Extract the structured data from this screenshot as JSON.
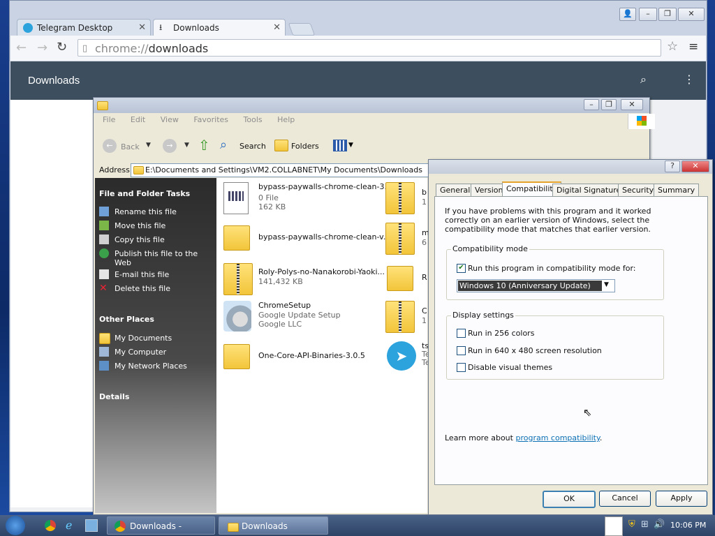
{
  "colors": {
    "chrome_header": "#3d4e5e",
    "xp_blue": "#0b2a6e",
    "accent_link": "#0b6fb3"
  },
  "chrome": {
    "tabs": [
      {
        "label": "Telegram Desktop",
        "icon": "telegram-icon"
      },
      {
        "label": "Downloads",
        "icon": "download-icon"
      }
    ],
    "url_scheme": "chrome://",
    "url_path": "downloads",
    "page_title": "Downloads"
  },
  "explorer": {
    "menu": [
      "File",
      "Edit",
      "View",
      "Favorites",
      "Tools",
      "Help"
    ],
    "toolbar": {
      "back": "Back",
      "search": "Search",
      "folders": "Folders"
    },
    "address_label": "Address",
    "address_value": "E:\\Documents and Settings\\VM2.COLLABNET\\My Documents\\Downloads",
    "file_tasks_title": "File and Folder Tasks",
    "file_tasks": [
      {
        "label": "Rename this file",
        "icon": "rename-icon"
      },
      {
        "label": "Move this file",
        "icon": "move-icon"
      },
      {
        "label": "Copy this file",
        "icon": "copy-icon"
      },
      {
        "label": "Publish this file to the Web",
        "icon": "publish-icon"
      },
      {
        "label": "E-mail this file",
        "icon": "email-icon"
      },
      {
        "label": "Delete this file",
        "icon": "delete-icon"
      }
    ],
    "other_places_title": "Other Places",
    "other_places": [
      {
        "label": "My Documents",
        "icon": "folder-icon"
      },
      {
        "label": "My Computer",
        "icon": "computer-icon"
      },
      {
        "label": "My Network Places",
        "icon": "network-icon"
      }
    ],
    "details_title": "Details",
    "files": [
      {
        "name": "bypass-paywalls-chrome-clean-3....",
        "sub1": "0 File",
        "sub2": "162 KB",
        "icon": "document-icon"
      },
      {
        "name": "bypass-paywalls-chrome-clean-v...",
        "sub1": "",
        "sub2": "",
        "icon": "folder-icon"
      },
      {
        "name": "Roly-Polys-no-Nanakorobi-Yaoki...",
        "sub1": "141,432 KB",
        "sub2": "",
        "icon": "zip-icon"
      },
      {
        "name": "ChromeSetup",
        "sub1": "Google Update Setup",
        "sub2": "Google LLC",
        "icon": "setup-icon"
      },
      {
        "name": "One-Core-API-Binaries-3.0.5",
        "sub1": "",
        "sub2": "",
        "icon": "folder-icon"
      }
    ],
    "files_col2": [
      {
        "name": "b",
        "sub1": "1",
        "icon": "zip-icon"
      },
      {
        "name": "m",
        "sub1": "6",
        "icon": "zip-icon"
      },
      {
        "name": "R",
        "sub1": "",
        "icon": "folder-icon"
      },
      {
        "name": "C",
        "sub1": "1",
        "icon": "zip-icon"
      },
      {
        "name": "ts",
        "sub1": "Te",
        "sub2": "Te",
        "icon": "telegram-icon"
      }
    ]
  },
  "properties": {
    "tabs": [
      "General",
      "Version",
      "Compatibility",
      "Digital Signatures",
      "Security",
      "Summary"
    ],
    "active_tab": "Compatibility",
    "intro": "If you have problems with this program and it worked correctly on an earlier version of Windows, select the compatibility mode that matches that earlier version.",
    "compat_group": "Compatibility mode",
    "compat_check": "Run this program in compatibility mode for:",
    "compat_select": "Windows 10 (Anniversary Update)",
    "display_group": "Display settings",
    "display_options": [
      "Run in 256 colors",
      "Run in 640 x 480 screen resolution",
      "Disable visual themes"
    ],
    "learn_prefix": "Learn more about ",
    "learn_link": "program compatibility",
    "learn_suffix": ".",
    "buttons": {
      "ok": "OK",
      "cancel": "Cancel",
      "apply": "Apply"
    }
  },
  "taskbar": {
    "items": [
      {
        "label": "Downloads - Googl...",
        "icon": "chrome-icon"
      },
      {
        "label": "Downloads",
        "icon": "folder-icon"
      }
    ],
    "clock": "10:06 PM"
  }
}
